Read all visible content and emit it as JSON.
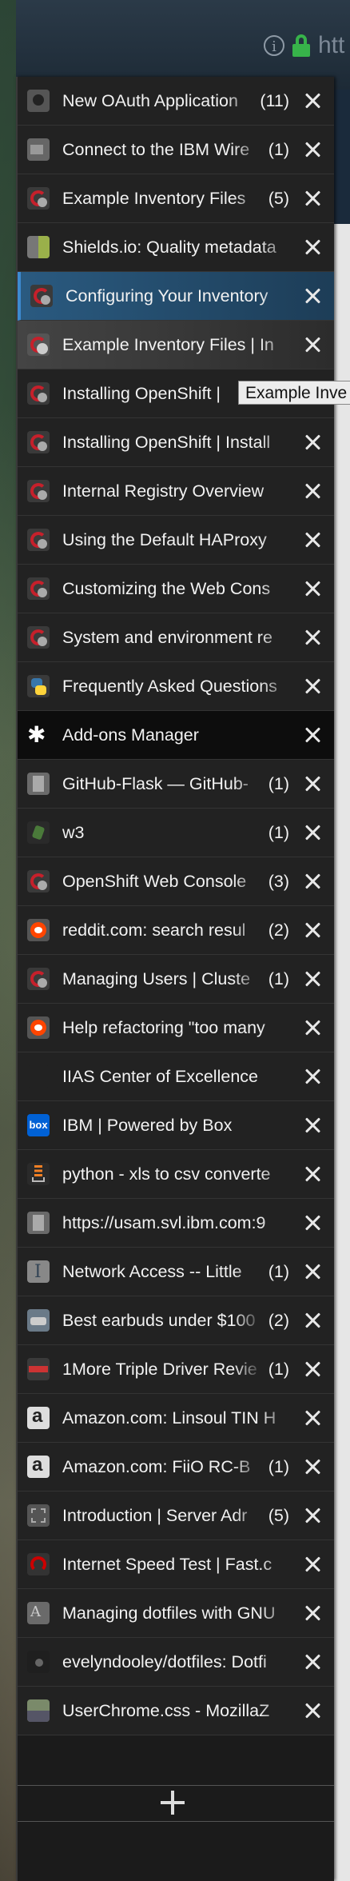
{
  "urlbar": {
    "text": "htt"
  },
  "tooltip": {
    "text": "Example Inve"
  },
  "tabs": [
    {
      "title": "New OAuth Application",
      "count": "(11)",
      "favicon": "github-icon",
      "state": "normal"
    },
    {
      "title": "Connect to the IBM Wire",
      "count": "(1)",
      "favicon": "ibm-icon",
      "state": "normal"
    },
    {
      "title": "Example Inventory Files",
      "count": "(5)",
      "favicon": "redhat-icon",
      "state": "normal"
    },
    {
      "title": "Shields.io: Quality metadata",
      "count": "",
      "favicon": "shields-icon",
      "state": "normal"
    },
    {
      "title": "Configuring Your Inventory",
      "count": "",
      "favicon": "redhat-icon",
      "state": "active"
    },
    {
      "title": "Example Inventory Files | In",
      "count": "",
      "favicon": "redhat-icon",
      "state": "selected"
    },
    {
      "title": "Installing OpenShift |",
      "count": "",
      "favicon": "redhat-icon",
      "state": "normal"
    },
    {
      "title": "Installing OpenShift | Install",
      "count": "",
      "favicon": "redhat-icon",
      "state": "normal"
    },
    {
      "title": "Internal Registry Overview",
      "count": "",
      "favicon": "redhat-icon",
      "state": "normal"
    },
    {
      "title": "Using the Default HAProxy",
      "count": "",
      "favicon": "redhat-icon",
      "state": "normal"
    },
    {
      "title": "Customizing the Web Cons",
      "count": "",
      "favicon": "redhat-icon",
      "state": "normal"
    },
    {
      "title": "System and environment re",
      "count": "",
      "favicon": "redhat-icon",
      "state": "normal"
    },
    {
      "title": "Frequently Asked Questions",
      "count": "",
      "favicon": "python-icon",
      "state": "normal"
    },
    {
      "title": "Add-ons Manager",
      "count": "",
      "favicon": "puzzle-icon",
      "state": "addons"
    },
    {
      "title": "GitHub-Flask — GitHub-",
      "count": "(1)",
      "favicon": "doc-icon",
      "state": "normal"
    },
    {
      "title": "w3",
      "count": "(1)",
      "favicon": "w3-icon",
      "state": "normal"
    },
    {
      "title": "OpenShift Web Console",
      "count": "(3)",
      "favicon": "redhat-icon",
      "state": "normal"
    },
    {
      "title": "reddit.com: search resul",
      "count": "(2)",
      "favicon": "reddit-icon",
      "state": "normal"
    },
    {
      "title": "Managing Users | Cluste",
      "count": "(1)",
      "favicon": "redhat-icon",
      "state": "normal"
    },
    {
      "title": "Help refactoring \"too many",
      "count": "",
      "favicon": "reddit-icon",
      "state": "normal"
    },
    {
      "title": "IIAS Center of Excellence",
      "count": "",
      "favicon": "dark-icon",
      "state": "normal"
    },
    {
      "title": "IBM | Powered by Box",
      "count": "",
      "favicon": "box-icon",
      "state": "normal"
    },
    {
      "title": "python - xls to csv converte",
      "count": "",
      "favicon": "stackoverflow-icon",
      "state": "normal"
    },
    {
      "title": "https://usam.svl.ibm.com:9",
      "count": "",
      "favicon": "page-icon",
      "state": "normal"
    },
    {
      "title": "Network Access -- Little",
      "count": "(1)",
      "favicon": "network-icon",
      "state": "normal"
    },
    {
      "title": "Best earbuds under $100",
      "count": "(2)",
      "favicon": "image-icon",
      "state": "normal"
    },
    {
      "title": "1More Triple Driver Revie",
      "count": "(1)",
      "favicon": "1more-icon",
      "state": "normal"
    },
    {
      "title": "Amazon.com: Linsoul TIN H",
      "count": "",
      "favicon": "amazon-icon",
      "state": "normal"
    },
    {
      "title": "Amazon.com: FiiO RC-B",
      "count": "(1)",
      "favicon": "amazon-icon",
      "state": "normal"
    },
    {
      "title": "Introduction | Server Adr",
      "count": "(5)",
      "favicon": "intro-icon",
      "state": "normal"
    },
    {
      "title": "Internet Speed Test | Fast.c",
      "count": "",
      "favicon": "fast-icon",
      "state": "normal"
    },
    {
      "title": "Managing dotfiles with GNU",
      "count": "",
      "favicon": "gnu-icon",
      "state": "normal"
    },
    {
      "title": "evelyndooley/dotfiles: Dotfi",
      "count": "",
      "favicon": "evelyn-icon",
      "state": "normal"
    },
    {
      "title": "UserChrome.css - MozillaZ",
      "count": "",
      "favicon": "mozilla-icon",
      "state": "normal"
    }
  ],
  "box_label": "box",
  "colors": {
    "accent": "#3d8ad0",
    "lock": "#37b34a",
    "sidebar_bg": "#1b1b1b"
  }
}
